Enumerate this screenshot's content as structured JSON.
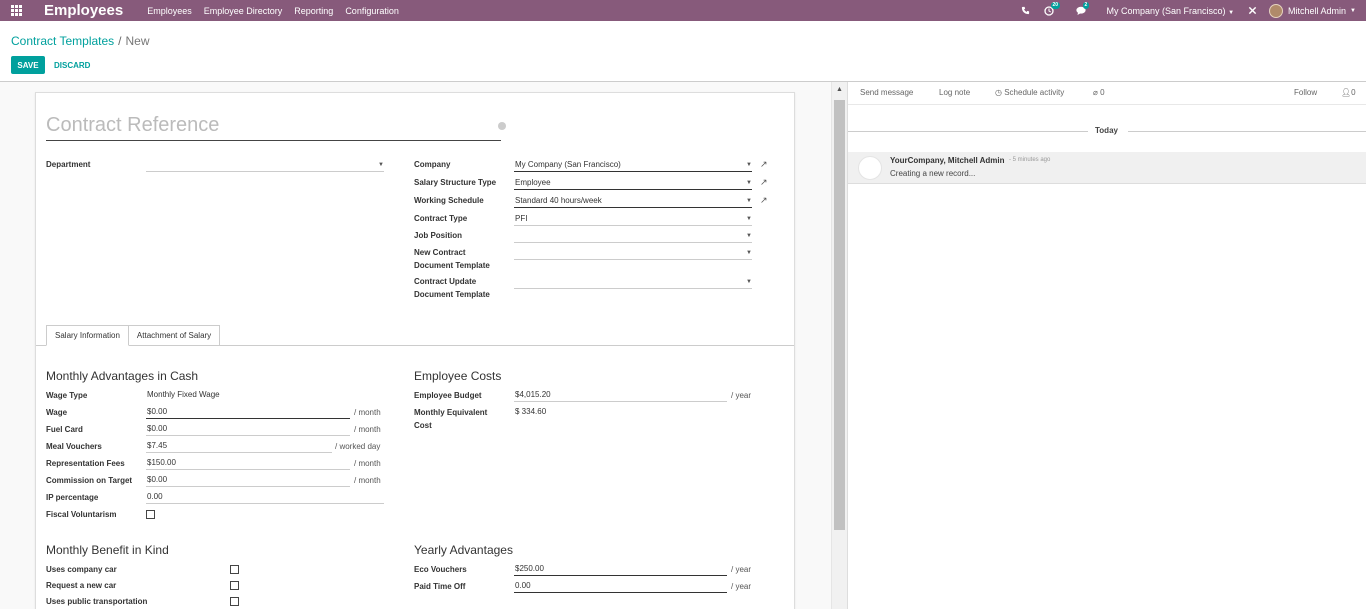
{
  "navbar": {
    "app_title": "Employees",
    "menu": [
      "Employees",
      "Employee Directory",
      "Reporting",
      "Configuration"
    ],
    "activity_badge": "20",
    "messages_badge": "2",
    "company": "My Company (San Francisco)",
    "user": "Mitchell Admin",
    "accent_color": "#875A7B"
  },
  "breadcrumb": {
    "parent": "Contract Templates",
    "separator": "/",
    "current": "New"
  },
  "actions": {
    "save": "SAVE",
    "discard": "DISCARD"
  },
  "form": {
    "title_placeholder": "Contract Reference",
    "department": {
      "label": "Department",
      "value": ""
    },
    "company": {
      "label": "Company",
      "value": "My Company (San Francisco)"
    },
    "salary_structure_type": {
      "label": "Salary Structure Type",
      "value": "Employee"
    },
    "working_schedule": {
      "label": "Working Schedule",
      "value": "Standard 40 hours/week"
    },
    "contract_type": {
      "label": "Contract Type",
      "value": "PFI"
    },
    "job_position": {
      "label": "Job Position",
      "value": ""
    },
    "new_contract_template": {
      "label_line1": "New Contract",
      "label_line2": "Document Template",
      "value": ""
    },
    "update_contract_template": {
      "label_line1": "Contract Update",
      "label_line2": "Document Template",
      "value": ""
    }
  },
  "tabs": [
    "Salary Information",
    "Attachment of Salary"
  ],
  "monthly_cash": {
    "title": "Monthly Advantages in Cash",
    "wage_type": {
      "label": "Wage Type",
      "value": "Monthly Fixed Wage"
    },
    "wage": {
      "label": "Wage",
      "value": "$0.00",
      "unit": "/ month"
    },
    "fuel_card": {
      "label": "Fuel Card",
      "value": "$0.00",
      "unit": "/ month"
    },
    "meal_vouchers": {
      "label": "Meal Vouchers",
      "value": "$7.45",
      "unit": "/ worked day"
    },
    "representation_fees": {
      "label": "Representation Fees",
      "value": "$150.00",
      "unit": "/ month"
    },
    "commission_on_target": {
      "label": "Commission on Target",
      "value": "$0.00",
      "unit": "/ month"
    },
    "ip_percentage": {
      "label": "IP percentage",
      "value": "0.00"
    },
    "fiscal_voluntarism": {
      "label": "Fiscal Voluntarism"
    }
  },
  "employee_costs": {
    "title": "Employee Costs",
    "budget": {
      "label": "Employee Budget",
      "value": "$4,015.20",
      "unit": "/ year"
    },
    "monthly_equivalent": {
      "label_line1": "Monthly Equivalent",
      "label_line2": "Cost",
      "value": "$ 334.60"
    }
  },
  "benefit_in_kind": {
    "title": "Monthly Benefit in Kind",
    "items": [
      "Uses company car",
      "Request a new car",
      "Uses public transportation"
    ]
  },
  "yearly_advantages": {
    "title": "Yearly Advantages",
    "eco_vouchers": {
      "label": "Eco Vouchers",
      "value": "$250.00",
      "unit": "/ year"
    },
    "paid_time_off": {
      "label": "Paid Time Off",
      "value": "0.00",
      "unit": "/ year"
    }
  },
  "chatter": {
    "send_message": "Send message",
    "log_note": "Log note",
    "schedule_activity": "Schedule activity",
    "attachments": "0",
    "follow": "Follow",
    "followers": "0",
    "today": "Today",
    "message": {
      "author": "YourCompany, Mitchell Admin",
      "time": "- 5 minutes ago",
      "body": "Creating a new record..."
    }
  }
}
